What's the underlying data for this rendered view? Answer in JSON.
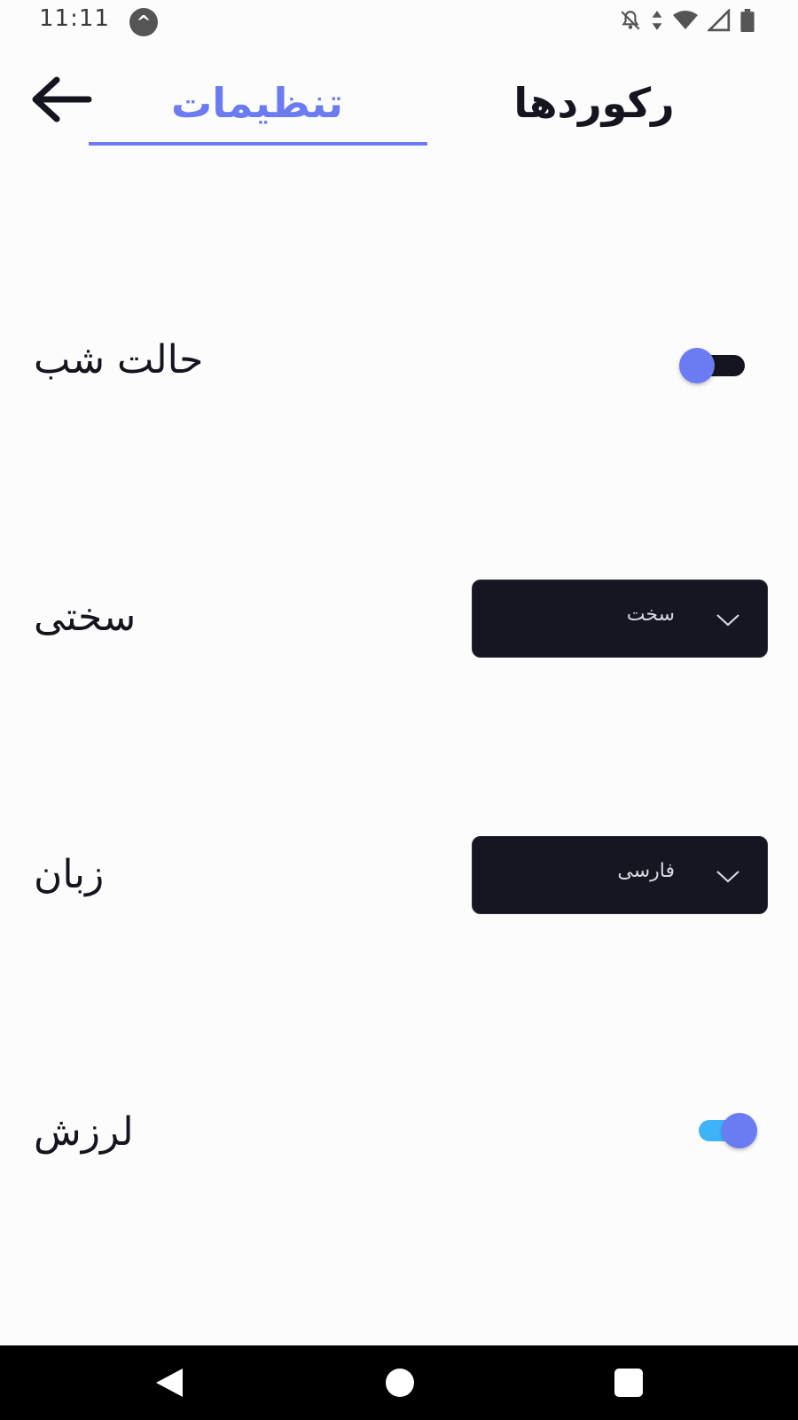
{
  "status_bar": {
    "time": "11:11",
    "app_icon": "expo-caret-icon",
    "icons": [
      "notifications-off-icon",
      "data-arrows-icon",
      "wifi-icon",
      "signal-icon",
      "battery-icon"
    ]
  },
  "header": {
    "back_icon": "arrow-left-icon",
    "tabs": [
      {
        "label": "تنظیمات",
        "active": true
      },
      {
        "label": "رکوردها",
        "active": false
      }
    ],
    "accent_color": "#6b7cf2"
  },
  "settings": {
    "night_mode": {
      "label": "حالت شب",
      "enabled": false
    },
    "difficulty": {
      "label": "سختی",
      "value": "سخت"
    },
    "language": {
      "label": "زبان",
      "value": "فارسی"
    },
    "vibration": {
      "label": "لرزش",
      "enabled": true
    }
  },
  "nav_bar": {
    "icons": [
      "nav-back-icon",
      "nav-home-icon",
      "nav-recents-icon"
    ]
  }
}
